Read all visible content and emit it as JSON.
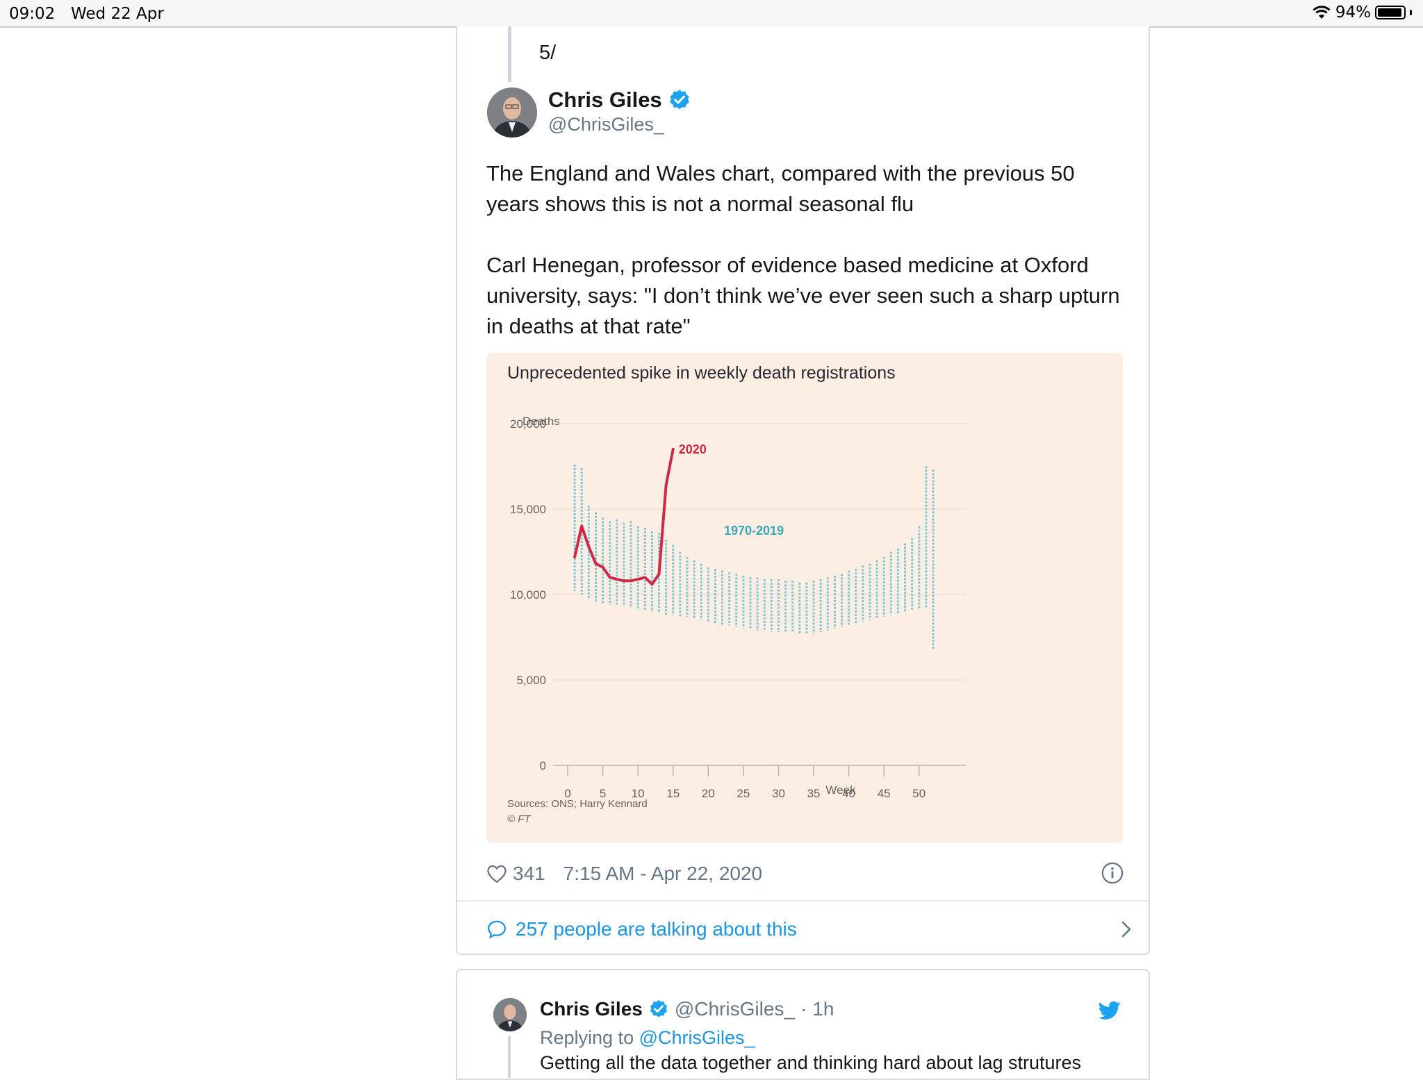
{
  "status_bar": {
    "time": "09:02",
    "date": "Wed 22 Apr",
    "battery": "94%",
    "battery_level": 0.94
  },
  "tweet": {
    "thread_number": "5/",
    "author_name": "Chris Giles",
    "author_handle": "@ChrisGiles_",
    "paragraphs": [
      "The England and Wales chart, compared with the previous 50 years shows this is not a normal seasonal flu",
      "Carl Henegan, professor of evidence based medicine at Oxford university, says: \"I don’t think we’ve ever seen such a sharp upturn in deaths at that rate\""
    ],
    "likes": "341",
    "timestamp": "7:15 AM - Apr 22, 2020",
    "talking": "257 people are talking about this"
  },
  "chart_data": {
    "type": "line",
    "title": "Unprecedented spike in weekly death registrations",
    "ylabel": "Deaths",
    "xlabel": "Week",
    "ylim": [
      0,
      20000
    ],
    "xlim": [
      0,
      52
    ],
    "yticks": [
      0,
      5000,
      10000,
      15000,
      20000
    ],
    "ytick_labels": [
      "0",
      "5,000",
      "10,000",
      "15,000",
      "20,000"
    ],
    "xticks": [
      0,
      5,
      10,
      15,
      20,
      25,
      30,
      35,
      40,
      45,
      50
    ],
    "source": "Sources: ONS; Harry Kennard",
    "credit": "© FT",
    "colors": {
      "line_2020": "#cc2b47",
      "history": "#7ec8d8",
      "background": "#fdeee3"
    },
    "series": [
      {
        "name": "2020",
        "x": [
          1,
          2,
          3,
          4,
          5,
          6,
          7,
          8,
          9,
          10,
          11,
          12,
          13,
          14,
          15
        ],
        "values": [
          12200,
          14000,
          12800,
          11800,
          11600,
          11000,
          10900,
          10800,
          10800,
          10900,
          11000,
          10600,
          11200,
          16400,
          18500
        ]
      }
    ],
    "history_series": {
      "name": "1970-2019",
      "week_ranges": [
        [
          1,
          10200,
          17600
        ],
        [
          2,
          10000,
          17400
        ],
        [
          3,
          9700,
          15200
        ],
        [
          4,
          9500,
          14800
        ],
        [
          5,
          9500,
          14500
        ],
        [
          6,
          9400,
          14300
        ],
        [
          7,
          9400,
          14400
        ],
        [
          8,
          9300,
          14200
        ],
        [
          9,
          9200,
          14300
        ],
        [
          10,
          9100,
          14000
        ],
        [
          11,
          9100,
          13900
        ],
        [
          12,
          9000,
          13700
        ],
        [
          13,
          8900,
          13600
        ],
        [
          14,
          8800,
          13200
        ],
        [
          15,
          8800,
          12900
        ],
        [
          16,
          8700,
          12500
        ],
        [
          17,
          8700,
          12200
        ],
        [
          18,
          8600,
          12000
        ],
        [
          19,
          8500,
          11800
        ],
        [
          20,
          8400,
          11600
        ],
        [
          21,
          8300,
          11500
        ],
        [
          22,
          8200,
          11400
        ],
        [
          23,
          8200,
          11300
        ],
        [
          24,
          8100,
          11200
        ],
        [
          25,
          8000,
          11100
        ],
        [
          26,
          8000,
          11000
        ],
        [
          27,
          7900,
          11000
        ],
        [
          28,
          7900,
          10900
        ],
        [
          29,
          7800,
          10900
        ],
        [
          30,
          7800,
          10900
        ],
        [
          31,
          7800,
          10800
        ],
        [
          32,
          7800,
          10800
        ],
        [
          33,
          7700,
          10700
        ],
        [
          34,
          7700,
          10700
        ],
        [
          35,
          7700,
          10800
        ],
        [
          36,
          7800,
          10900
        ],
        [
          37,
          7900,
          11000
        ],
        [
          38,
          8000,
          11100
        ],
        [
          39,
          8100,
          11200
        ],
        [
          40,
          8200,
          11400
        ],
        [
          41,
          8300,
          11500
        ],
        [
          42,
          8400,
          11700
        ],
        [
          43,
          8500,
          11800
        ],
        [
          44,
          8600,
          12000
        ],
        [
          45,
          8700,
          12200
        ],
        [
          46,
          8800,
          12500
        ],
        [
          47,
          8900,
          12700
        ],
        [
          48,
          9000,
          13000
        ],
        [
          49,
          9100,
          13300
        ],
        [
          50,
          9200,
          14000
        ],
        [
          51,
          9200,
          17500
        ],
        [
          52,
          6800,
          17300
        ]
      ]
    }
  },
  "reply": {
    "author_name": "Chris Giles",
    "author_handle": "@ChrisGiles_",
    "separator": "·",
    "time": "1h",
    "replying_label": "Replying to ",
    "replying_handle": "@ChrisGiles_",
    "text": "Getting all the data together and thinking hard about lag strutures"
  }
}
